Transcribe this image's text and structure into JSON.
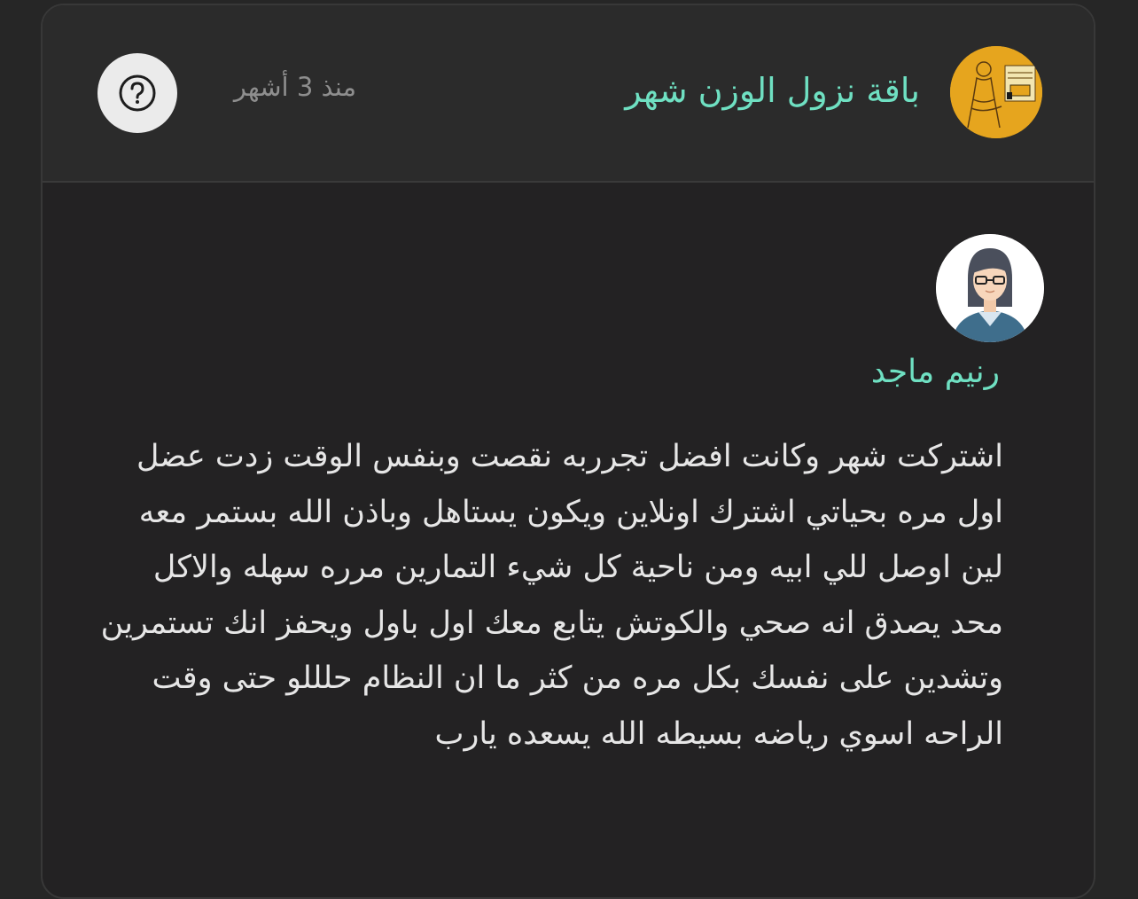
{
  "header": {
    "package_title": "باقة نزول الوزن شهر",
    "time_ago": "منذ 3 أشهر",
    "help_icon": "question-circle-icon"
  },
  "review": {
    "reviewer_name": "رنيم ماجد",
    "text": "اشتركت شهر وكانت افضل تجرربه نقصت وبنفس الوقت زدت عضل اول مره بحياتي اشترك اونلاين ويكون يستاهل وباذن الله بستمر معه لين اوصل للي ابيه ومن ناحية كل شيء التمارين مرره سهله والاكل محد يصدق انه صحي والكوتش يتابع معك اول باول ويحفز انك تستمرين وتشدين على نفسك بكل مره من كثر ما ان النظام حلللو حتى وقت الراحه اسوي رياضه بسيطه الله يسعده يارب"
  },
  "colors": {
    "background": "#262626",
    "header_bg": "#2b2b2b",
    "accent": "#6fe0c2",
    "muted_text": "#8e8e8e",
    "body_text": "#e6e6e6",
    "package_avatar_bg": "#e6a51e"
  }
}
